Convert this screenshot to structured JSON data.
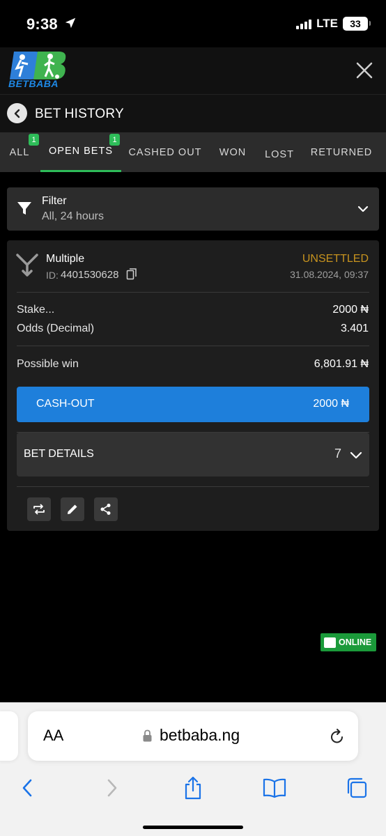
{
  "status_bar": {
    "time": "9:38",
    "network": "LTE",
    "battery": "33"
  },
  "header": {
    "logo_text": "BETBABA"
  },
  "page": {
    "title": "BET HISTORY"
  },
  "tabs": [
    {
      "label": "ALL",
      "badge": "1"
    },
    {
      "label": "OPEN BETS",
      "badge": "1"
    },
    {
      "label": "CASHED OUT"
    },
    {
      "label": "WON"
    },
    {
      "label": "LOST"
    },
    {
      "label": "RETURNED"
    }
  ],
  "active_tab": "OPEN BETS",
  "filter": {
    "title": "Filter",
    "value": "All, 24 hours"
  },
  "bet": {
    "type": "Multiple",
    "id_label": "ID:",
    "id": "4401530628",
    "status": "UNSETTLED",
    "date": "31.08.2024, 09:37",
    "stake_label": "Stake...",
    "stake": "2000 ₦",
    "odds_label": "Odds (Decimal)",
    "odds": "3.401",
    "possible_win_label": "Possible win",
    "possible_win": "6,801.91 ₦",
    "cashout_label": "CASH-OUT",
    "cashout_amount": "2000 ₦",
    "details_label": "BET DETAILS",
    "details_count": "7"
  },
  "online_badge": "ONLINE",
  "browser": {
    "aa_label": "AA",
    "url": "betbaba.ng"
  },
  "colors": {
    "accent_green": "#2ebd59",
    "cashout_blue": "#1e7fdb",
    "status_unsettled": "#c7931e",
    "safari_blue": "#1a73e8"
  }
}
